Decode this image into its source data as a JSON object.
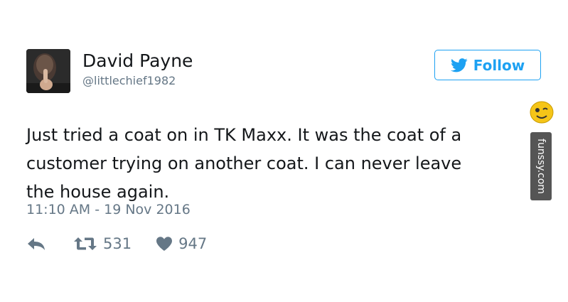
{
  "user": {
    "name": "David Payne",
    "handle": "@littlechief1982"
  },
  "follow_button": {
    "label": "Follow",
    "icon": "twitter-bird-icon",
    "color": "#1da1f2"
  },
  "tweet": {
    "lines": [
      "Just tried a coat on in TK Maxx. It was the coat of a",
      "customer trying on another coat. I can never leave",
      "the house again."
    ],
    "timestamp": "11:10 AM - 19 Nov 2016"
  },
  "actions": {
    "reply_icon": "reply-icon",
    "retweet_icon": "retweet-icon",
    "retweet_count": "531",
    "like_icon": "heart-icon",
    "like_count": "947"
  },
  "watermark": {
    "text": "funssy.com"
  }
}
